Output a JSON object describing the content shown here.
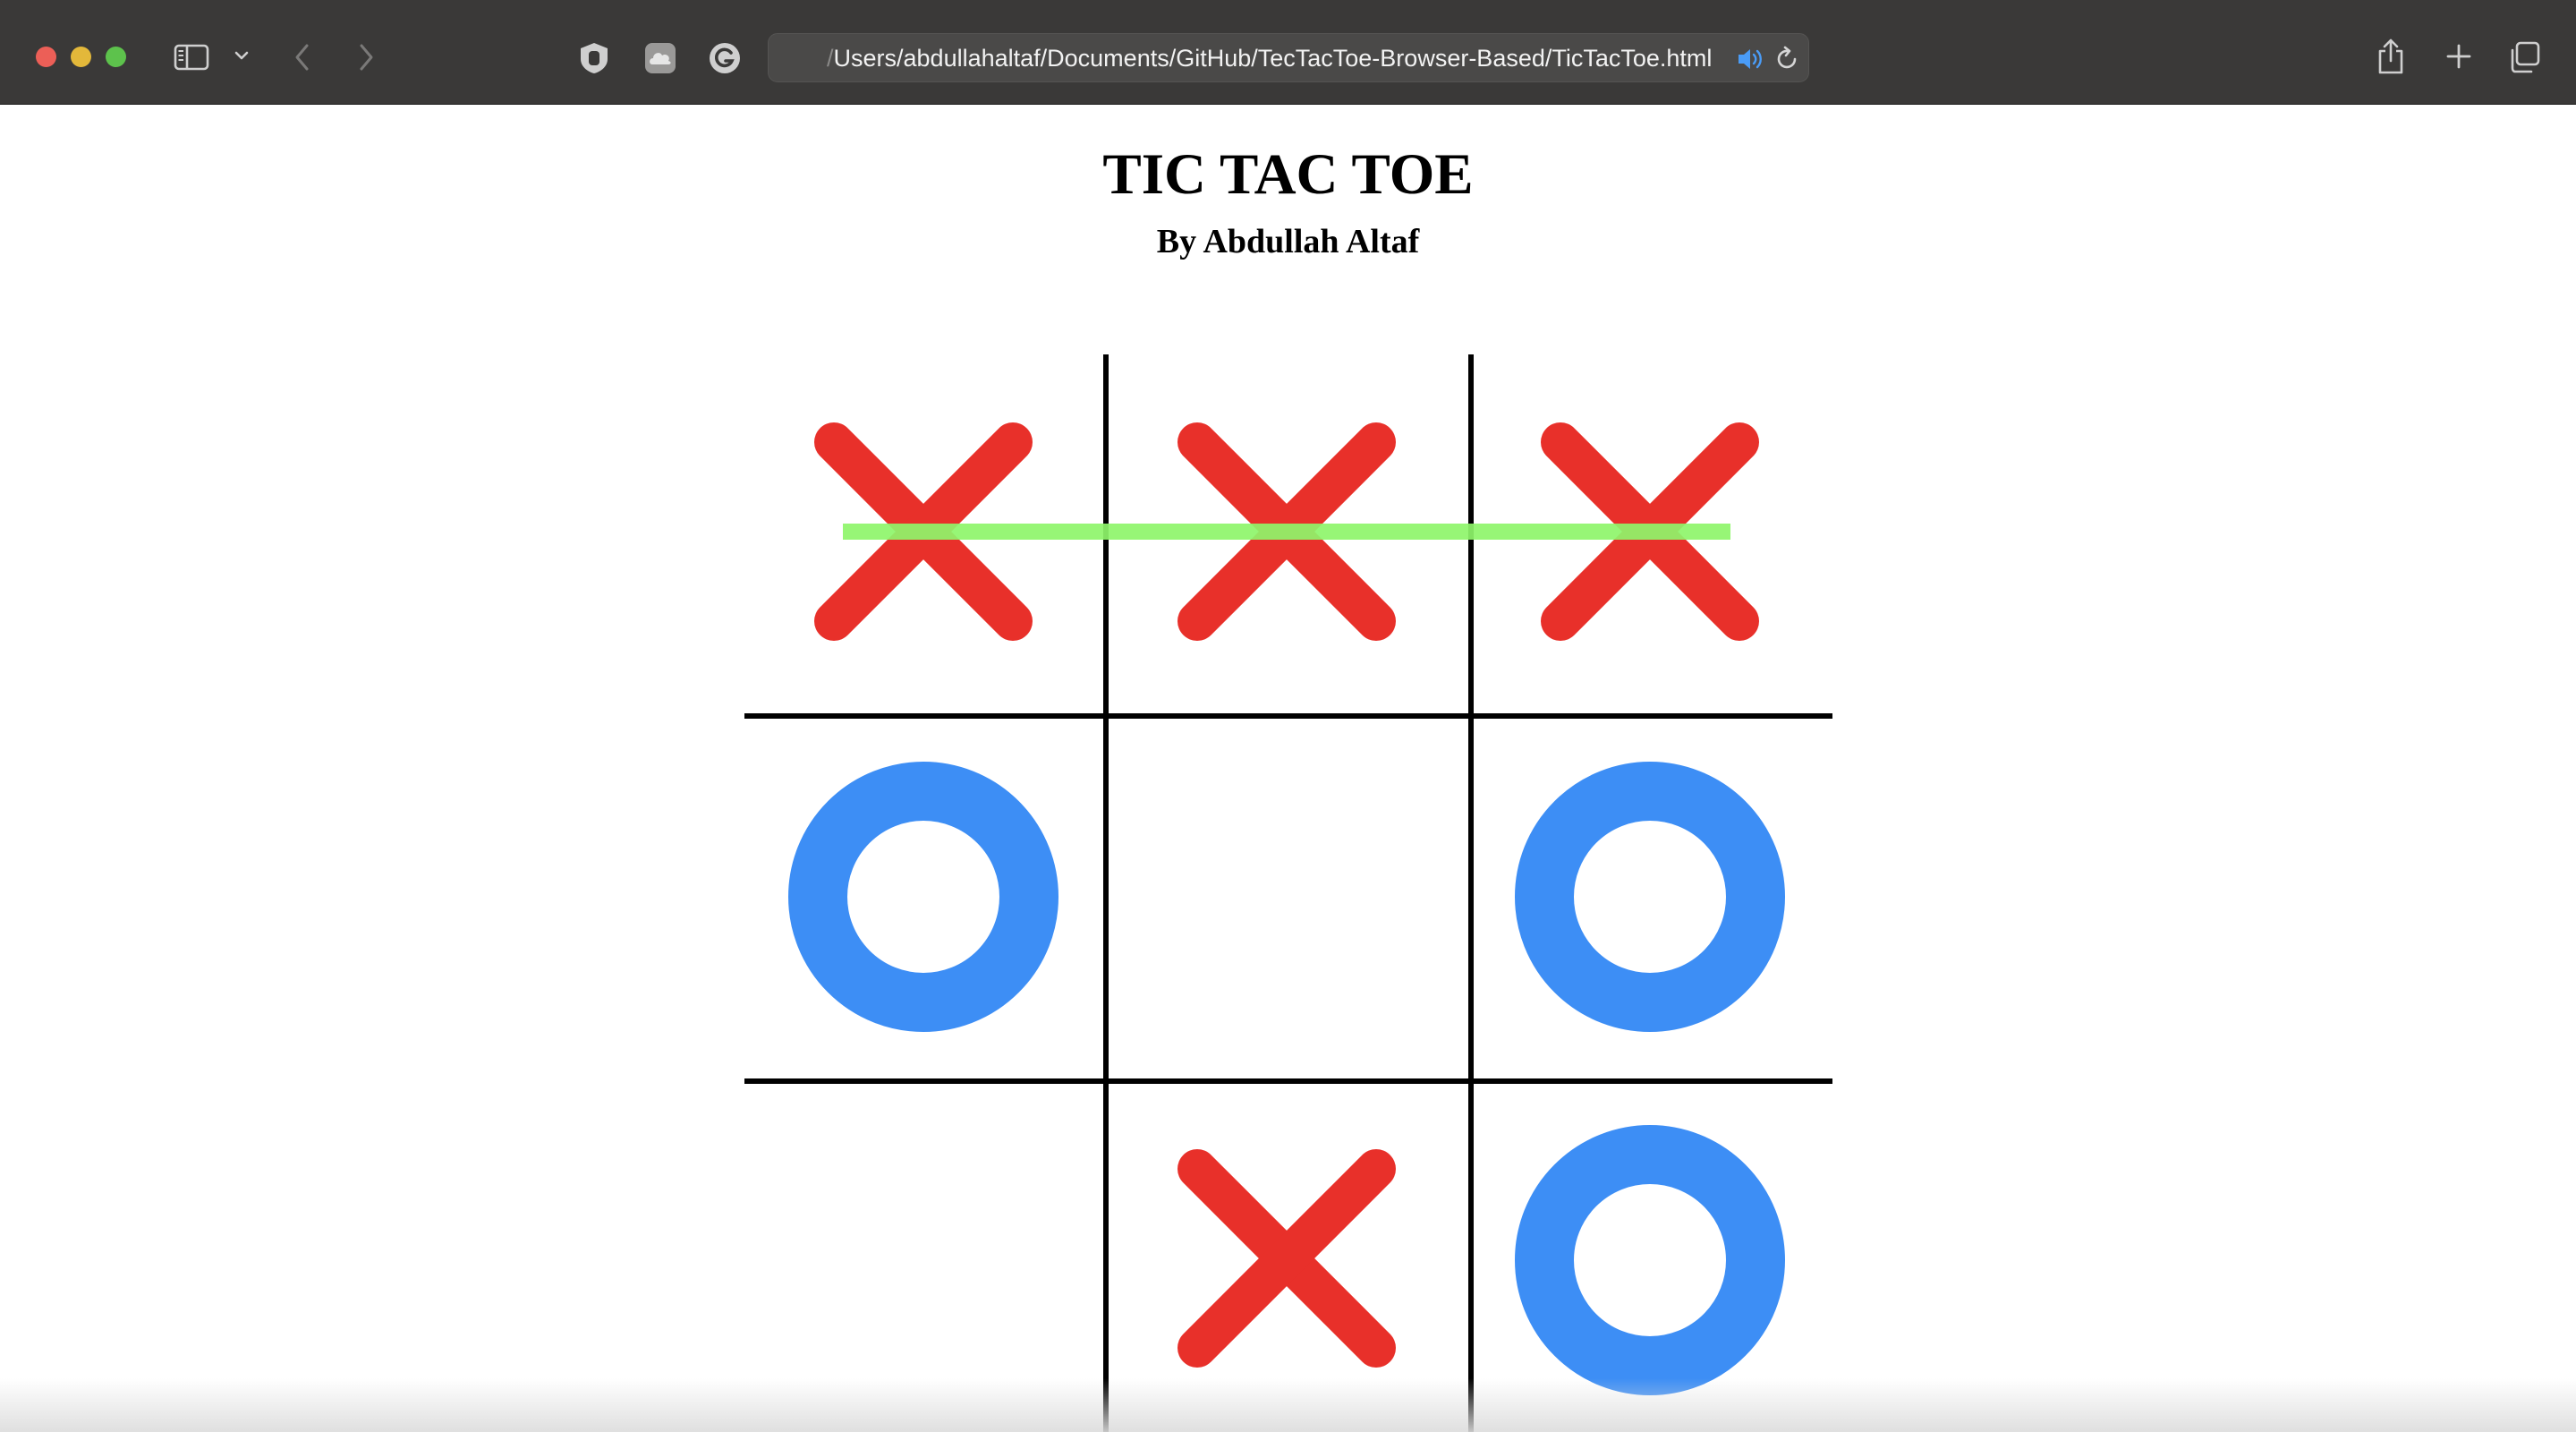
{
  "browser": {
    "address_prefix": "/",
    "address_path": "Users/abdullahaltaf/Documents/GitHub/TecTacToe-Browser-Based/TicTacToe.html"
  },
  "page": {
    "title": "TIC TAC TOE",
    "subtitle": "By Abdullah Altaf"
  },
  "game": {
    "cells": [
      "X",
      "X",
      "X",
      "O",
      "",
      "O",
      "",
      "X",
      "O"
    ],
    "winning_row": [
      0,
      1,
      2
    ]
  },
  "colors": {
    "x_mark": "#e8302a",
    "o_mark": "#3d8ef5",
    "win_line": "#8ef56a",
    "grid": "#000000"
  }
}
